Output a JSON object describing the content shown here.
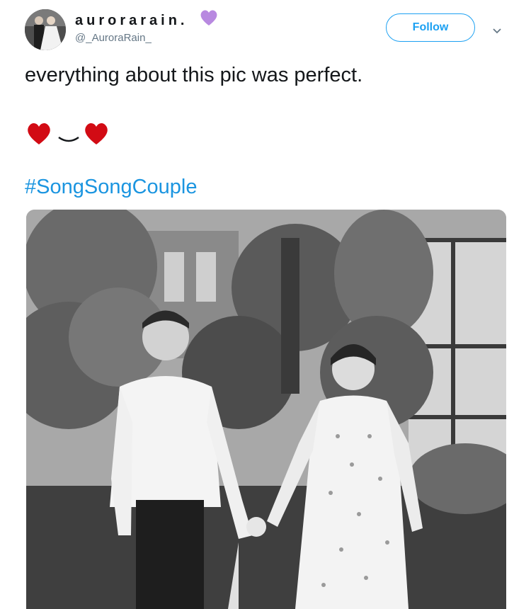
{
  "user": {
    "display_name": "aurorarain.",
    "handle": "@_AuroraRain_",
    "badge_icon": "purple-heart-icon",
    "badge_color": "#b889e0"
  },
  "actions": {
    "follow_label": "Follow",
    "menu_icon": "chevron-down-icon"
  },
  "tweet": {
    "text": "everything about this pic was perfect.",
    "emoji_icons": [
      "red-heart-icon",
      "smile-mouth-icon",
      "red-heart-icon"
    ],
    "hashtag": "#SongSongCouple"
  },
  "colors": {
    "link_blue": "#1b95e0",
    "follow_blue": "#1da1f2",
    "heart_red": "#d20b14",
    "handle_gray": "#657786"
  }
}
